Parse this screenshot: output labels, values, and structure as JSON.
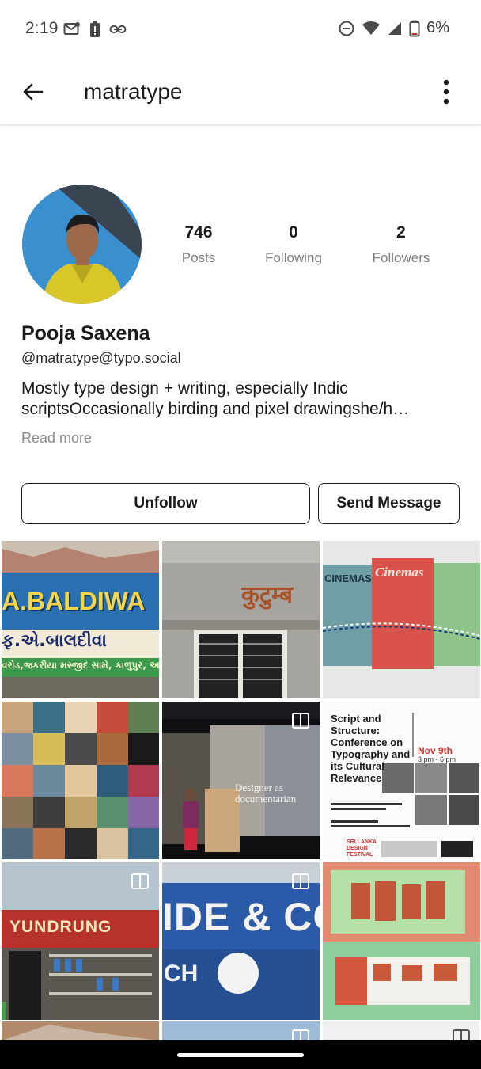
{
  "status_bar": {
    "time": "2:19",
    "battery": "6%",
    "icons_left": [
      "mail-icon",
      "battery-alert-icon",
      "link-icon"
    ],
    "icons_right": [
      "do-not-disturb-icon",
      "wifi-icon",
      "signal-icon",
      "battery-icon"
    ]
  },
  "toolbar": {
    "title": "matratype",
    "back_icon": "arrow-left-icon",
    "menu_icon": "more-vertical-icon"
  },
  "profile": {
    "name": "Pooja Saxena",
    "handle": "@matratype@typo.social",
    "bio_line1": "Mostly type design + writing, especially Indic",
    "bio_line2": "scriptsOccasionally birding and pixel drawingshe/h…",
    "read_more": "Read more",
    "stats": [
      {
        "value": "746",
        "label": "Posts"
      },
      {
        "value": "0",
        "label": "Following"
      },
      {
        "value": "2",
        "label": "Followers"
      }
    ]
  },
  "actions": {
    "unfollow": "Unfollow",
    "send_message": "Send Message"
  },
  "grid": {
    "tile_texts": {
      "baldiwala_sign": "A.BALDIWA",
      "baldiwala_gujarati": "ફ.એ.બાલદીવા",
      "baldiwala_small": "વરોડ,જકરીયા મસ્જીદ સામે, કાળુપુર, અ",
      "kutumb_sign": "कुटुम्ब",
      "cinemas_1": "CINEMAS",
      "cinemas_2": "Cinemas",
      "talk_slide": "Designer as documentarian",
      "conf_title": "Script and Structure: Conference on Typography and its Cultural Relevance",
      "conf_date": "Nov 9th",
      "conf_time": "3 pm - 6 pm",
      "conf_festival": "SRI LANKA DESIGN FESTIVAL",
      "yundrung_sign": "YUNDRUNG",
      "hide_sign": "IDE & CO",
      "hide_sub": "CH"
    },
    "multi_icon": "multiple-images-icon"
  },
  "colors": {
    "accent_text": "#1a1a1a",
    "muted": "#808080",
    "nav_bg": "#000000"
  }
}
